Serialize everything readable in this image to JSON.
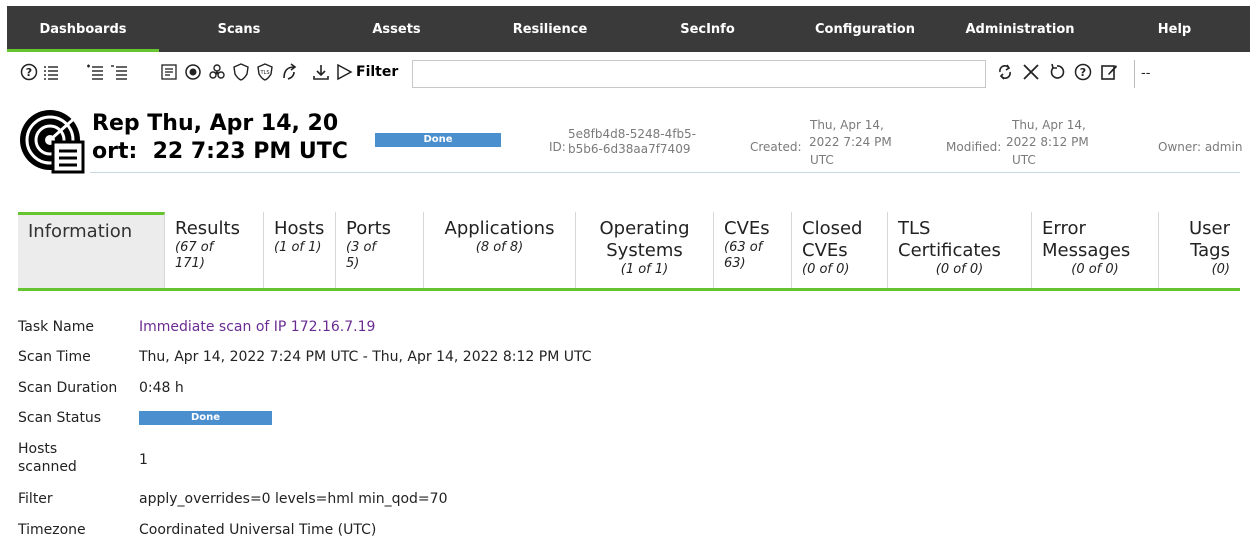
{
  "nav": {
    "items": [
      "Dashboards",
      "Scans",
      "Assets",
      "Resilience",
      "SecInfo",
      "Configuration",
      "Administration",
      "Help"
    ]
  },
  "toolbar": {
    "filter_label": "Filter",
    "filter_value": "",
    "select_value": "--",
    "icons": [
      "help-icon",
      "list-icon",
      "indent-icon",
      "outdent-icon",
      "filter-list-icon",
      "exclude-icon",
      "bio-hazard-icon",
      "shield-icon",
      "tls-shield-icon",
      "arrows-icon",
      "download-icon",
      "play-icon",
      "refresh-icon",
      "close-icon",
      "reset-icon",
      "question-icon",
      "edit-icon"
    ]
  },
  "report": {
    "title_line1": "Rep Thu, Apr 14, 20",
    "title_line2": "ort:  22 7:23 PM UTC",
    "status": "Done",
    "id_label": "ID:",
    "id_value_1": "5e8fb4d8-5248-4fb5-",
    "id_value_2": "b5b6-6d38aa7f7409",
    "created_label": "Created:",
    "created_line1": "Thu, Apr 14,",
    "created_line2": "2022 7:24 PM",
    "created_line3": "UTC",
    "modified_label": "Modified:",
    "modified_line1": "Thu, Apr 14,",
    "modified_line2": "2022 8:12 PM",
    "modified_line3": "UTC",
    "owner": "Owner: admin"
  },
  "tabs": [
    {
      "label": "Information",
      "count": ""
    },
    {
      "label": "Results",
      "count": "(67 of 171)"
    },
    {
      "label": "Hosts",
      "count": "(1 of 1)"
    },
    {
      "label": "Ports",
      "count": "(3 of 5)"
    },
    {
      "label": "Applications",
      "count": "(8 of 8)"
    },
    {
      "label": "Operating Systems",
      "count": "(1 of 1)"
    },
    {
      "label": "CVEs",
      "count": "(63 of 63)"
    },
    {
      "label": "Closed CVEs",
      "count": "(0 of 0)"
    },
    {
      "label": "TLS Certificates",
      "count": "(0 of 0)"
    },
    {
      "label": "Error Messages",
      "count": "(0 of 0)"
    },
    {
      "label": "User Tags",
      "count": "(0)"
    }
  ],
  "details": {
    "task_name_label": "Task Name",
    "task_name_value": "Immediate scan of IP 172.16.7.19",
    "scan_time_label": "Scan Time",
    "scan_time_value": "Thu, Apr 14, 2022 7:24 PM UTC - Thu, Apr 14, 2022 8:12 PM UTC",
    "scan_duration_label": "Scan Duration",
    "scan_duration_value": "0:48 h",
    "scan_status_label": "Scan Status",
    "scan_status_value": "Done",
    "hosts_scanned_label_1": "Hosts",
    "hosts_scanned_label_2": "scanned",
    "hosts_scanned_value": "1",
    "filter_label": "Filter",
    "filter_value": "apply_overrides=0 levels=hml min_qod=70",
    "timezone_label": "Timezone",
    "timezone_value": "Coordinated Universal Time (UTC)"
  },
  "colors": {
    "nav_bg": "#3a3a3a",
    "accent_green": "#66c430",
    "status_blue": "#4c8fcf",
    "link_purple": "#6a2c91"
  }
}
